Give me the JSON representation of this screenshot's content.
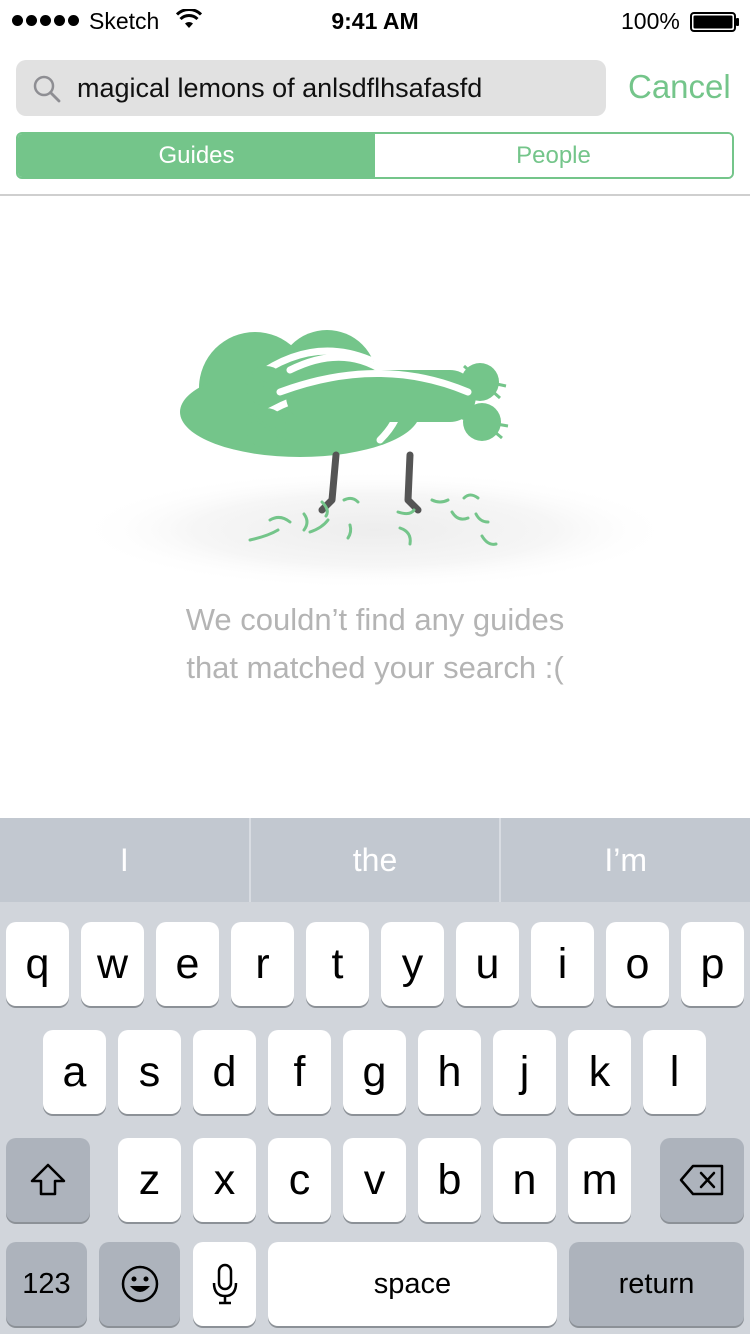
{
  "status_bar": {
    "carrier": "Sketch",
    "time": "9:41 AM",
    "battery": "100%"
  },
  "search": {
    "query": "magical lemons of anlsdflhsafasfd",
    "cancel_label": "Cancel"
  },
  "segments": [
    {
      "label": "Guides",
      "selected": true
    },
    {
      "label": "People",
      "selected": false
    }
  ],
  "empty_state": {
    "line1": "We couldn’t find any guides",
    "line2": "that matched your search :("
  },
  "keyboard": {
    "suggestions": [
      "I",
      "the",
      "I’m"
    ],
    "row1": [
      "q",
      "w",
      "e",
      "r",
      "t",
      "y",
      "u",
      "i",
      "o",
      "p"
    ],
    "row2": [
      "a",
      "s",
      "d",
      "f",
      "g",
      "h",
      "j",
      "k",
      "l"
    ],
    "row3": [
      "z",
      "x",
      "c",
      "v",
      "b",
      "n",
      "m"
    ],
    "numbers_label": "123",
    "space_label": "space",
    "return_label": "return"
  },
  "colors": {
    "accent": "#74c58a",
    "muted_text": "#b4b4b4",
    "keyboard_bg": "#d1d5db"
  }
}
